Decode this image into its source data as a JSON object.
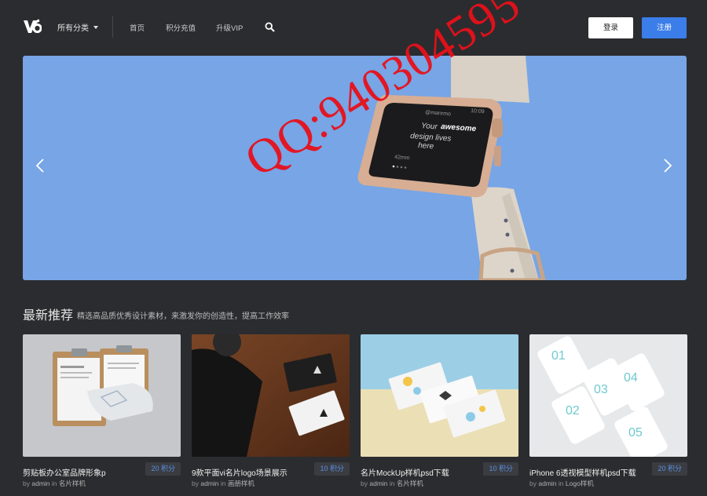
{
  "header": {
    "logo_text": "V6",
    "category_label": "所有分类",
    "nav": [
      "首页",
      "积分充值",
      "升级VIP"
    ],
    "login_label": "登录",
    "register_label": "注册"
  },
  "banner": {
    "watch_lines": [
      "@manrmo",
      "10:09",
      "Your",
      "awesome",
      "design lives",
      "here",
      "42mm"
    ]
  },
  "watermark": "QQ:940304595",
  "section": {
    "title": "最新推荐",
    "subtitle": "精选高品质优秀设计素材，来激发你的创造性，提高工作效率"
  },
  "cards": [
    {
      "title": "剪贴板办公室品牌形象p",
      "points": "20 积分",
      "by": "by",
      "author": "admin",
      "in": "in",
      "category": "名片样机"
    },
    {
      "title": "9款平面vi名片logo场景展示",
      "points": "10 积分",
      "by": "by",
      "author": "admin",
      "in": "in",
      "category": "画册样机"
    },
    {
      "title": "名片MockUp样机psd下载",
      "points": "10 积分",
      "by": "by",
      "author": "admin",
      "in": "in",
      "category": "名片样机"
    },
    {
      "title": "iPhone 6透视模型样机psd下载",
      "points": "20 积分",
      "by": "by",
      "author": "admin",
      "in": "in",
      "category": "Logo样机"
    }
  ],
  "colors": {
    "background": "#2b2c2f",
    "banner": "#77a5e6",
    "primary": "#3b7de9",
    "watermark": "#e8101a"
  }
}
